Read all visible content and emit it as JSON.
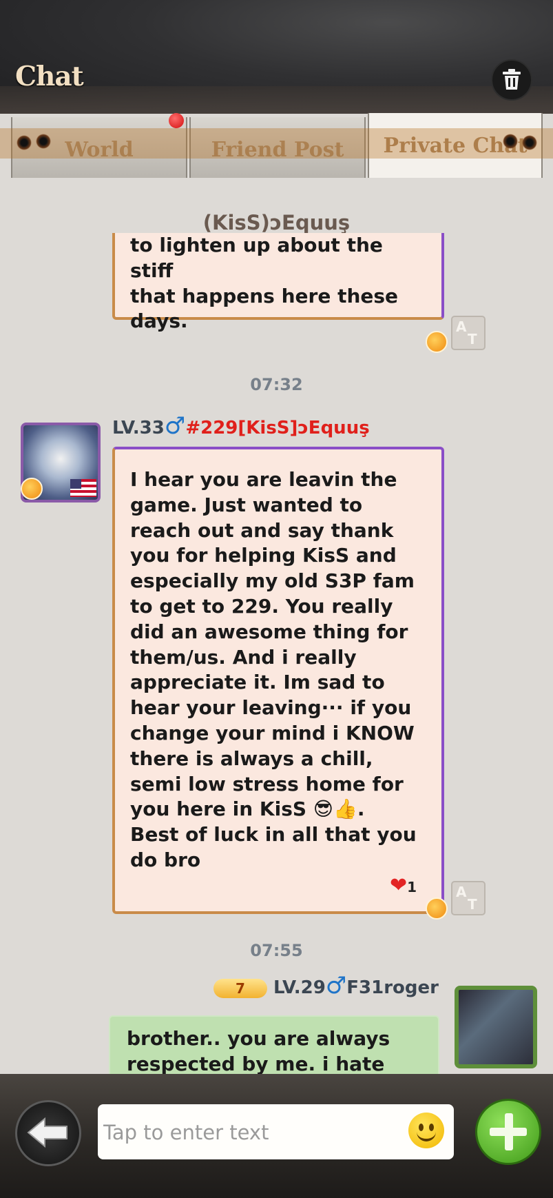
{
  "header": {
    "title": "Chat",
    "trash_icon": "trash-icon"
  },
  "tabs": [
    {
      "label": "World",
      "has_notification": true
    },
    {
      "label": "Friend Post"
    },
    {
      "label": "Private Chat",
      "active": true
    }
  ],
  "conversation": {
    "title": "(KisS)ↄEquuş"
  },
  "messages": [
    {
      "text": "to lighten up about the stiff\nthat happens here these\ndays."
    },
    {
      "timestamp": "07:32",
      "level": "LV.33",
      "gender_symbol": "♂",
      "sender": "#229[KisS]ↄEquuş",
      "avatar_flag": "US",
      "text": "I hear you are leavin the\ngame. Just wanted to\nreach out and say thank\nyou for helping KisS and\nespecially my old S3P fam\nto get to 229. You really\ndid an awesome thing for\nthem/us. And i really\nappreciate it. Im sad to\nhear your leaving··· if you\nchange your mind i KNOW\nthere is always a chill,\nsemi low stress home for\nyou here in KisS 😎👍.\nBest of luck in all that you\ndo bro",
      "reaction": "❤",
      "reaction_count": "1"
    },
    {
      "timestamp": "07:55",
      "vip": "7",
      "level": "LV.29",
      "gender_symbol": "♂",
      "sender": "F31roger",
      "text": "brother.. you are always\nrespected by me. i hate"
    }
  ],
  "translate_label": "A文",
  "input": {
    "placeholder": "Tap to enter text"
  },
  "colors": {
    "bubble_bg": "#fbe8df",
    "own_bubble_bg": "#bfe0b0",
    "sender_red": "#e0201b",
    "gender_blue": "#1f74c8"
  }
}
